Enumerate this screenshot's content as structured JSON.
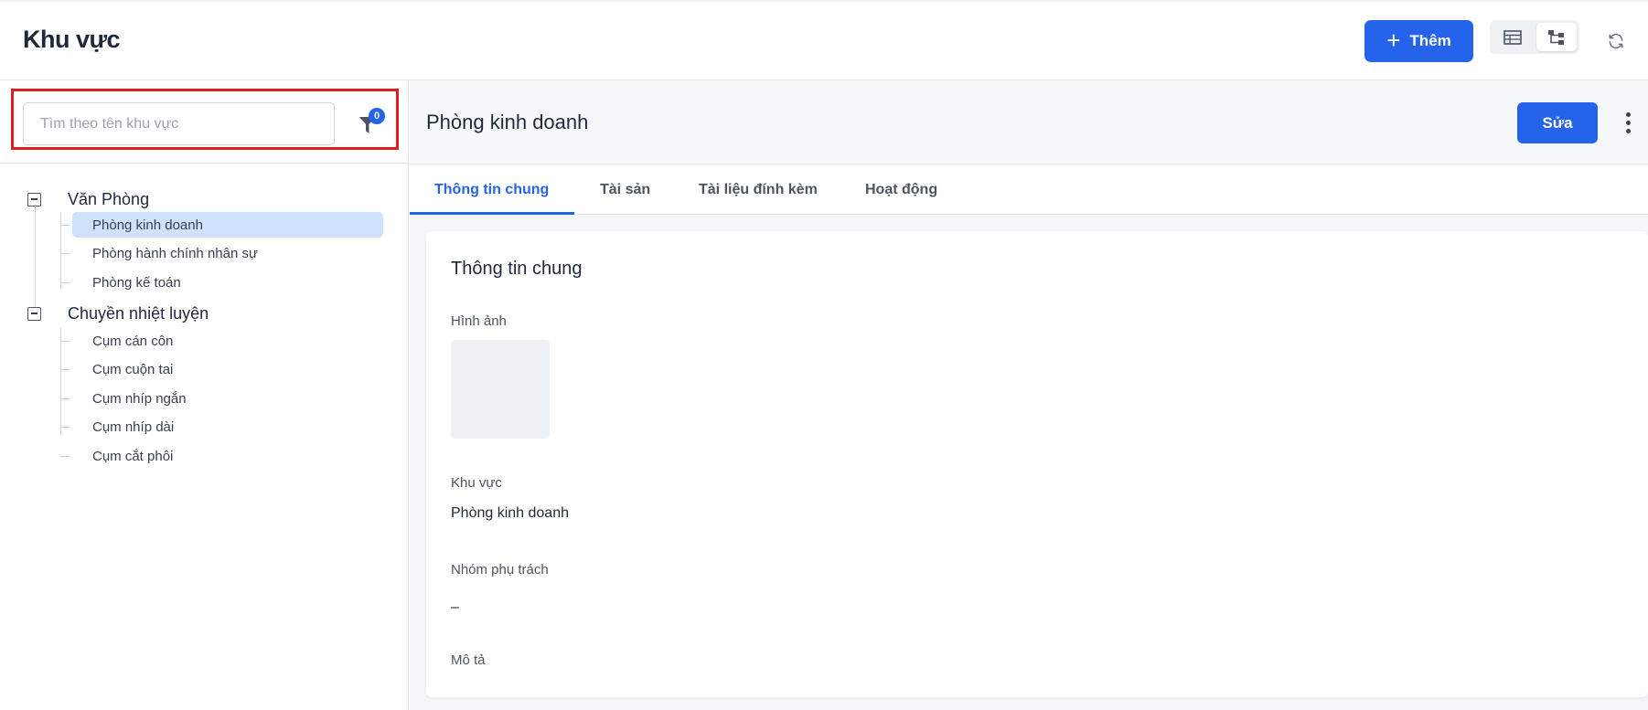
{
  "header": {
    "title": "Khu vực",
    "add_label": "Thêm",
    "plus_icon": "plus-icon",
    "view_table_icon": "table-view-icon",
    "view_tree_icon": "tree-view-icon",
    "refresh_icon": "refresh-icon"
  },
  "sidebar": {
    "search_placeholder": "Tìm theo tên khu vực",
    "search_value": "",
    "filter_count": "0",
    "tree": [
      {
        "label": "Văn Phòng",
        "children": [
          "Phòng kinh doanh",
          "Phòng hành chính nhân sự",
          "Phòng kế toán"
        ]
      },
      {
        "label": "Chuyền nhiệt luyện",
        "children": [
          "Cụm cán côn",
          "Cụm cuộn tai",
          "Cụm nhíp ngắn",
          "Cụm nhíp dài",
          "Cụm cắt phôi"
        ]
      }
    ]
  },
  "detail": {
    "title": "Phòng kinh doanh",
    "edit_label": "Sửa",
    "tabs": [
      "Thông tin chung",
      "Tài sản",
      "Tài liệu đính kèm",
      "Hoạt động"
    ],
    "card": {
      "title": "Thông tin chung",
      "image_label": "Hình ảnh",
      "area_label": "Khu vực",
      "area_value": "Phòng kinh doanh",
      "group_label": "Nhóm phụ trách",
      "group_value": "–",
      "desc_label": "Mô tả"
    }
  },
  "colors": {
    "accent": "#2563eb",
    "selected_bg": "#cfe2fb",
    "highlight_border": "#e11d22"
  }
}
